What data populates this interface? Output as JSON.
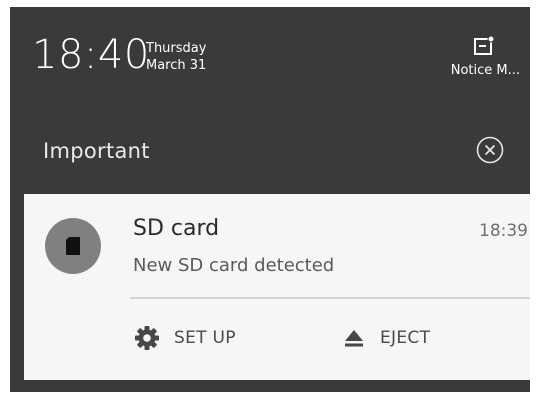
{
  "status": {
    "time": "18:40",
    "day": "Thursday",
    "date": "March 31",
    "notice_icon": "notice-manager-icon",
    "notice_label": "Notice M..."
  },
  "section": {
    "title": "Important",
    "dismiss_icon": "close-circle-icon"
  },
  "notification": {
    "app_icon": "sd-card-icon",
    "title": "SD card",
    "time": "18:39",
    "body": "New SD card detected",
    "actions": [
      {
        "icon": "gear-icon",
        "label": "SET UP"
      },
      {
        "icon": "eject-icon",
        "label": "EJECT"
      }
    ]
  },
  "colors": {
    "shade_background": "#3a3a3a",
    "card_background": "#f6f6f6",
    "avatar_gray": "#808080"
  }
}
